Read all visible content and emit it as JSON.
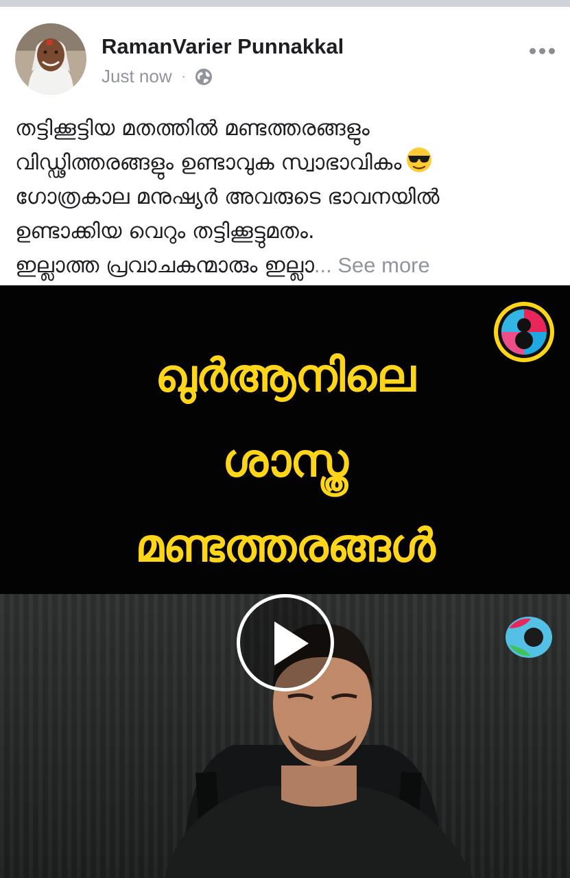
{
  "post": {
    "author": "RamanVarier Punnakkal",
    "timestamp": "Just now",
    "separator": "·",
    "privacy_icon": "globe-icon",
    "more_icon": "more-options-icon",
    "text_lines": [
      "തട്ടിക്കൂട്ടിയ മതത്തിൽ മണ്ടത്തരങ്ങളും",
      "വിഡ്ഢിത്തരങ്ങളും ഉണ്ടാവുക സ്വാഭാവികം",
      " ഗോത്രകാല മനുഷ്യർ അവരുടെ ഭാവനയിൽ",
      "ഉണ്ടാക്കിയ  വെറും തട്ടിക്കൂട്ടുമതം.",
      " ഇല്ലാത്ത പ്രവാചകന്മാരും  ഇല്ലാ"
    ],
    "emoji": "sunglasses-emoji",
    "ellipsis": "...",
    "see_more": " See more"
  },
  "video": {
    "title_lines": [
      "ഖുർആനിലെ",
      "ശാസ്ത്ര",
      "മണ്ടത്തരങ്ങൾ"
    ],
    "play_icon": "play-icon",
    "title_color": "#ffd51a"
  }
}
